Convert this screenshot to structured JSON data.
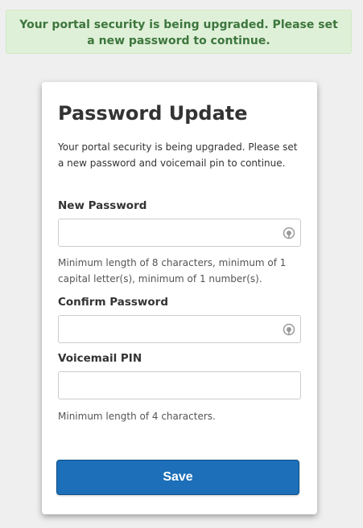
{
  "alert": {
    "text": "Your portal security is being upgraded. Please set a new password to continue."
  },
  "card": {
    "title": "Password Update",
    "intro": "Your portal security is being upgraded. Please set a new password and voicemail pin to continue."
  },
  "form": {
    "new_password": {
      "label": "New Password",
      "value": "",
      "help": "Minimum length of 8 characters, minimum of 1 capital letter(s), minimum of 1 number(s)."
    },
    "confirm_password": {
      "label": "Confirm Password",
      "value": ""
    },
    "voicemail_pin": {
      "label": "Voicemail PIN",
      "value": "",
      "help": "Minimum length of 4 characters."
    }
  },
  "save_label": "Save",
  "icons": {
    "password_field_icon": "password-manager-icon"
  },
  "colors": {
    "alert_bg": "#dff0d8",
    "alert_text": "#3c763d",
    "primary_button": "#1c6fb8",
    "page_bg": "#efefef"
  }
}
